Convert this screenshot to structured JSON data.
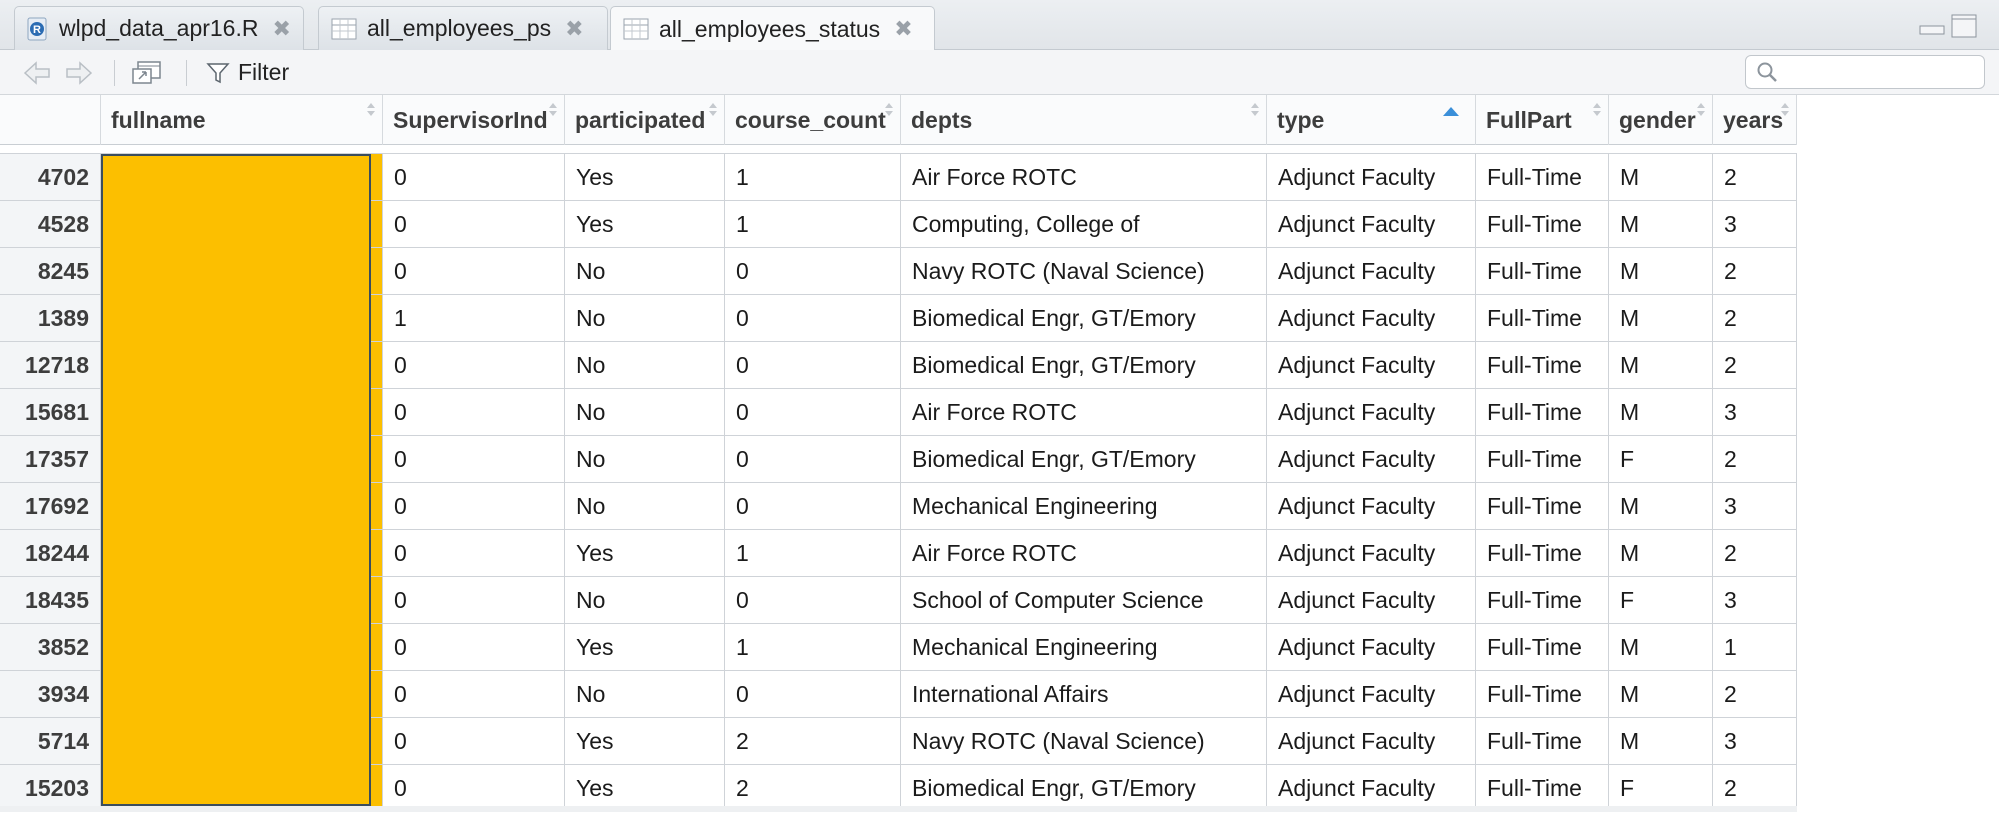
{
  "tabs": [
    {
      "label": "wlpd_data_apr16.R",
      "icon": "r-file-icon",
      "active": false
    },
    {
      "label": "all_employees_ps",
      "icon": "table-icon",
      "active": false
    },
    {
      "label": "all_employees_status",
      "icon": "table-icon",
      "active": true
    }
  ],
  "toolbar": {
    "filter_label": "Filter",
    "search_placeholder": ""
  },
  "table": {
    "columns": [
      "",
      "fullname",
      "SupervisorInd",
      "participated",
      "course_count",
      "depts",
      "type",
      "FullPart",
      "gender",
      "years"
    ],
    "sorted_column": "type",
    "sort_direction": "ascending",
    "masked_column": "fullname",
    "rows": [
      {
        "id": "4702",
        "fullname": "",
        "SupervisorInd": "0",
        "participated": "Yes",
        "course_count": "1",
        "depts": "Air Force ROTC",
        "type": "Adjunct Faculty",
        "FullPart": "Full-Time",
        "gender": "M",
        "years": "2"
      },
      {
        "id": "4528",
        "fullname": "",
        "SupervisorInd": "0",
        "participated": "Yes",
        "course_count": "1",
        "depts": "Computing, College of",
        "type": "Adjunct Faculty",
        "FullPart": "Full-Time",
        "gender": "M",
        "years": "3"
      },
      {
        "id": "8245",
        "fullname": "",
        "SupervisorInd": "0",
        "participated": "No",
        "course_count": "0",
        "depts": "Navy ROTC (Naval Science)",
        "type": "Adjunct Faculty",
        "FullPart": "Full-Time",
        "gender": "M",
        "years": "2"
      },
      {
        "id": "1389",
        "fullname": "",
        "SupervisorInd": "1",
        "participated": "No",
        "course_count": "0",
        "depts": "Biomedical Engr, GT/Emory",
        "type": "Adjunct Faculty",
        "FullPart": "Full-Time",
        "gender": "M",
        "years": "2"
      },
      {
        "id": "12718",
        "fullname": "",
        "SupervisorInd": "0",
        "participated": "No",
        "course_count": "0",
        "depts": "Biomedical Engr, GT/Emory",
        "type": "Adjunct Faculty",
        "FullPart": "Full-Time",
        "gender": "M",
        "years": "2"
      },
      {
        "id": "15681",
        "fullname": "",
        "SupervisorInd": "0",
        "participated": "No",
        "course_count": "0",
        "depts": "Air Force ROTC",
        "type": "Adjunct Faculty",
        "FullPart": "Full-Time",
        "gender": "M",
        "years": "3"
      },
      {
        "id": "17357",
        "fullname": "",
        "SupervisorInd": "0",
        "participated": "No",
        "course_count": "0",
        "depts": "Biomedical Engr, GT/Emory",
        "type": "Adjunct Faculty",
        "FullPart": "Full-Time",
        "gender": "F",
        "years": "2"
      },
      {
        "id": "17692",
        "fullname": "",
        "SupervisorInd": "0",
        "participated": "No",
        "course_count": "0",
        "depts": "Mechanical Engineering",
        "type": "Adjunct Faculty",
        "FullPart": "Full-Time",
        "gender": "M",
        "years": "3"
      },
      {
        "id": "18244",
        "fullname": "",
        "SupervisorInd": "0",
        "participated": "Yes",
        "course_count": "1",
        "depts": "Air Force ROTC",
        "type": "Adjunct Faculty",
        "FullPart": "Full-Time",
        "gender": "M",
        "years": "2"
      },
      {
        "id": "18435",
        "fullname": "",
        "SupervisorInd": "0",
        "participated": "No",
        "course_count": "0",
        "depts": "School of Computer Science",
        "type": "Adjunct Faculty",
        "FullPart": "Full-Time",
        "gender": "F",
        "years": "3"
      },
      {
        "id": "3852",
        "fullname": "",
        "SupervisorInd": "0",
        "participated": "Yes",
        "course_count": "1",
        "depts": "Mechanical Engineering",
        "type": "Adjunct Faculty",
        "FullPart": "Full-Time",
        "gender": "M",
        "years": "1"
      },
      {
        "id": "3934",
        "fullname": "",
        "SupervisorInd": "0",
        "participated": "No",
        "course_count": "0",
        "depts": "International Affairs",
        "type": "Adjunct Faculty",
        "FullPart": "Full-Time",
        "gender": "M",
        "years": "2"
      },
      {
        "id": "5714",
        "fullname": "",
        "SupervisorInd": "0",
        "participated": "Yes",
        "course_count": "2",
        "depts": "Navy ROTC (Naval Science)",
        "type": "Adjunct Faculty",
        "FullPart": "Full-Time",
        "gender": "M",
        "years": "3"
      },
      {
        "id": "15203",
        "fullname": "",
        "SupervisorInd": "0",
        "participated": "Yes",
        "course_count": "2",
        "depts": "Biomedical Engr, GT/Emory",
        "type": "Adjunct Faculty",
        "FullPart": "Full-Time",
        "gender": "F",
        "years": "2"
      }
    ]
  },
  "colors": {
    "redaction": "#fcbf00",
    "sort_indicator": "#3a8fd9"
  }
}
